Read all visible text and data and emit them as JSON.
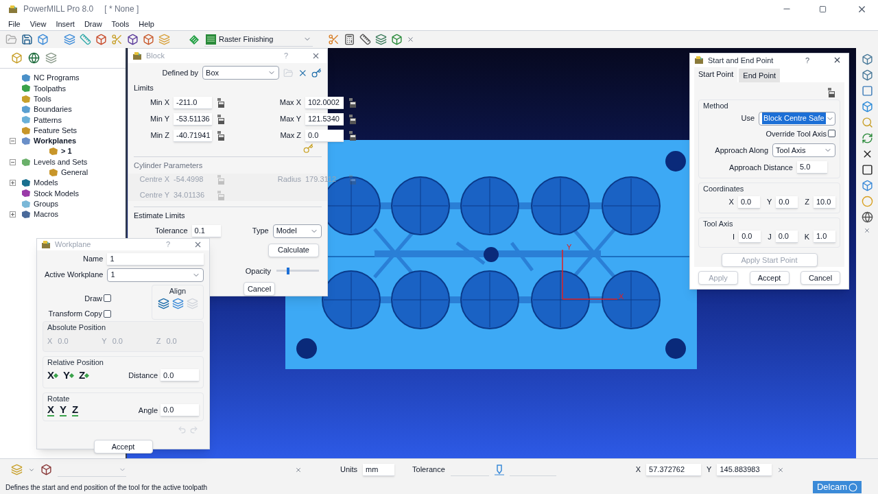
{
  "window": {
    "title": "PowerMILL Pro 8.0",
    "document": "[ * None ]"
  },
  "menu": [
    "File",
    "View",
    "Insert",
    "Draw",
    "Tools",
    "Help"
  ],
  "toolbar": {
    "strategy": "Raster Finishing"
  },
  "explorer": {
    "items": [
      {
        "label": "NC Programs",
        "active": false
      },
      {
        "label": "Toolpaths",
        "active": false
      },
      {
        "label": "Tools",
        "active": false
      },
      {
        "label": "Boundaries",
        "active": false
      },
      {
        "label": "Patterns",
        "active": false
      },
      {
        "label": "Feature Sets",
        "active": false
      },
      {
        "label": "Workplanes",
        "active": true,
        "expanded": true,
        "children": [
          {
            "label": "> 1",
            "active": true
          }
        ]
      },
      {
        "label": "Levels and Sets",
        "active": false,
        "expanded": true,
        "children": [
          {
            "label": "General",
            "active": false
          }
        ]
      },
      {
        "label": "Models",
        "active": false,
        "expanded": false
      },
      {
        "label": "Stock Models",
        "active": false
      },
      {
        "label": "Groups",
        "active": false
      },
      {
        "label": "Macros",
        "active": false,
        "expanded": false
      }
    ]
  },
  "viewport": {
    "axis_labels": [
      "Y",
      "X"
    ]
  },
  "block_dialog": {
    "title": "Block",
    "help": "?",
    "defined_by_label": "Defined by",
    "defined_by": "Box",
    "limits_title": "Limits",
    "limits": [
      {
        "label": "Min X",
        "value": "-211.0"
      },
      {
        "label": "Max X",
        "value": "102.0002"
      },
      {
        "label": "Min Y",
        "value": "-53.51136"
      },
      {
        "label": "Max Y",
        "value": "121.5340"
      },
      {
        "label": "Min Z",
        "value": "-40.71941"
      },
      {
        "label": "Max Z",
        "value": "0.0"
      }
    ],
    "cylinder": {
      "title": "Cylinder Parameters",
      "disabled": true,
      "fields": [
        {
          "label": "Centre X",
          "value": "-54.4998"
        },
        {
          "label": "Radius",
          "value": "179.3112"
        },
        {
          "label": "Centre Y",
          "value": "34.01136"
        }
      ]
    },
    "estimate": {
      "title": "Estimate Limits",
      "tolerance_label": "Tolerance",
      "tolerance": "0.1",
      "type_label": "Type",
      "type": "Model",
      "calculate": "Calculate"
    },
    "opacity": {
      "label": "Opacity",
      "level": 0.25
    },
    "cancel": "Cancel"
  },
  "workplane_dialog": {
    "title": "Workplane",
    "help": "?",
    "name_label": "Name",
    "name": "1",
    "active_label": "Active Workplane",
    "active": "1",
    "checks": [
      {
        "label": "Draw",
        "checked": false
      },
      {
        "label": "Transform Copy",
        "checked": false
      }
    ],
    "align_title": "Align",
    "absolute": {
      "title": "Absolute Position",
      "disabled": true,
      "fields": [
        {
          "label": "X",
          "value": "0.0"
        },
        {
          "label": "Y",
          "value": "0.0"
        },
        {
          "label": "Z",
          "value": "0.0"
        }
      ]
    },
    "relative": {
      "title": "Relative Position",
      "axes": [
        "X",
        "Y",
        "Z"
      ],
      "distance_label": "Distance",
      "distance": "0.0"
    },
    "rotate": {
      "title": "Rotate",
      "axes": [
        "X",
        "Y",
        "Z"
      ],
      "angle_label": "Angle",
      "angle": "0.0"
    },
    "accept": "Accept"
  },
  "start_end_dialog": {
    "title": "Start and End Point",
    "help": "?",
    "tabs": [
      {
        "label": "Start Point",
        "selected": true
      },
      {
        "label": "End Point",
        "selected": false
      }
    ],
    "method": {
      "title": "Method",
      "use_label": "Use",
      "use": "Block Centre Safe",
      "override_label": "Override Tool Axis",
      "override_checked": false,
      "approach_label": "Approach Along",
      "approach": "Tool Axis",
      "distance_label": "Approach Distance",
      "distance": "5.0"
    },
    "coordinates": {
      "title": "Coordinates",
      "fields": [
        {
          "label": "X",
          "value": "0.0"
        },
        {
          "label": "Y",
          "value": "0.0"
        },
        {
          "label": "Z",
          "value": "10.0"
        }
      ]
    },
    "tool_axis": {
      "title": "Tool Axis",
      "fields": [
        {
          "label": "I",
          "value": "0.0"
        },
        {
          "label": "J",
          "value": "0.0"
        },
        {
          "label": "K",
          "value": "1.0"
        }
      ]
    },
    "apply_start": {
      "label": "Apply Start Point",
      "disabled": true
    },
    "buttons": [
      {
        "label": "Apply",
        "disabled": true
      },
      {
        "label": "Accept",
        "disabled": false
      },
      {
        "label": "Cancel",
        "disabled": false
      }
    ]
  },
  "bottom_toolbar": {
    "units_label": "Units",
    "units": "mm",
    "tolerance_label": "Tolerance",
    "cursor": [
      {
        "label": "X",
        "value": "57.372762"
      },
      {
        "label": "Y",
        "value": "145.883983"
      }
    ]
  },
  "status_bar": {
    "message": "Defines the start and end position of the tool for the active toolpath",
    "logo": "Delcam"
  }
}
